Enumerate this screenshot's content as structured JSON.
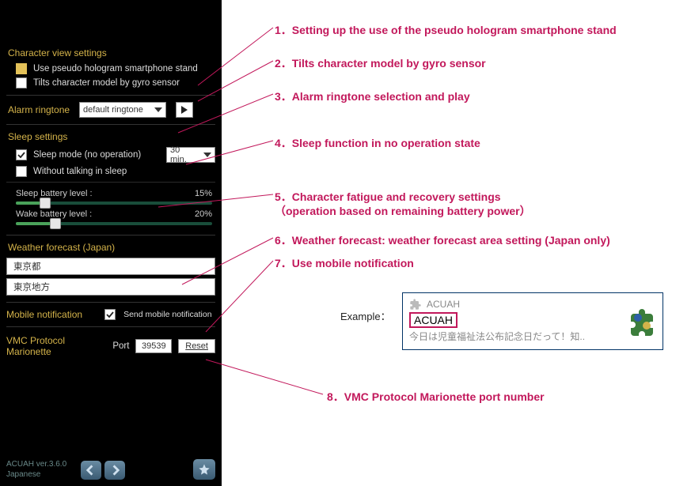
{
  "phone": {
    "char_view_title": "Character view settings",
    "use_hologram_label": "Use pseudo hologram smartphone stand",
    "tilt_gyro_label": "Tilts character model by gyro sensor",
    "alarm_title": "Alarm ringtone",
    "alarm_value": "default ringtone",
    "sleep_title": "Sleep settings",
    "sleep_mode_label": "Sleep mode (no operation)",
    "sleep_duration": "30 min.",
    "without_talking_label": "Without talking in sleep",
    "sleep_batt_label": "Sleep battery level :",
    "sleep_batt_value": "15%",
    "wake_batt_label": "Wake battery level :",
    "wake_batt_value": "20%",
    "weather_title": "Weather forecast (Japan)",
    "weather_pref": "東京都",
    "weather_area": "東京地方",
    "mobile_notif_title": "Mobile notification",
    "mobile_notif_label": "Send mobile notification",
    "vmc_title": "VMC Protocol Marionette",
    "port_label": "Port",
    "port_value": "39539",
    "reset_label": "Reset",
    "version_line1": "ACUAH ver.3.6.0",
    "version_line2": "Japanese"
  },
  "annotations": {
    "a1": "1．Setting up the use of the pseudo hologram smartphone stand",
    "a2": "2．Tilts character model by gyro sensor",
    "a3": "3．Alarm ringtone selection and play",
    "a4": "4．Sleep function in no operation state",
    "a5a": "5．Character fatigue and recovery settings",
    "a5b": "（operation based on remaining battery power）",
    "a6": "6．Weather forecast: weather forecast area setting (Japan only)",
    "a7": "7．Use mobile notification",
    "a8": "8．VMC Protocol Marionette port number",
    "example_label": "Example：",
    "notif_app": "ACUAH",
    "notif_title": "ACUAH",
    "notif_body": "今日は児童福祉法公布記念日だって！知.."
  }
}
